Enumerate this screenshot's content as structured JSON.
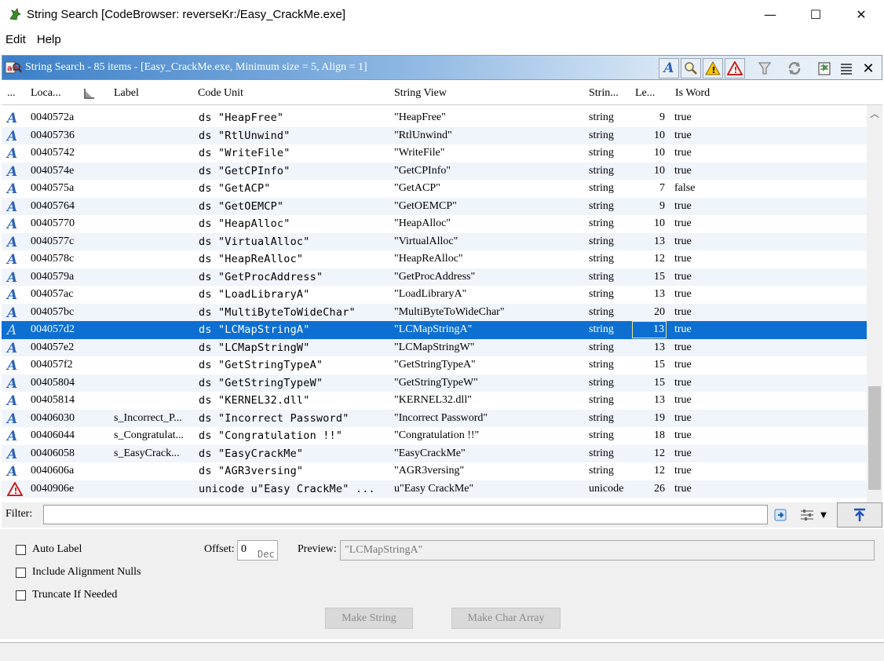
{
  "window": {
    "title": "String Search [CodeBrowser: reverseKr:/Easy_CrackMe.exe]",
    "controls": {
      "minimize": "—",
      "maximize": "☐",
      "close": "✕"
    }
  },
  "menu": [
    "Edit",
    "Help"
  ],
  "panel": {
    "title": "String Search - 85 items - [Easy_CrackMe.exe, Minimum size = 5, Align = 1]",
    "accent": "#3b7fc8"
  },
  "columns": {
    "icon": "...",
    "location": "Loca...",
    "label": "Label",
    "code_unit": "Code Unit",
    "string_view": "String View",
    "string_type": "Strin...",
    "length": "Le...",
    "is_word": "Is Word"
  },
  "rows": [
    {
      "icon": "A",
      "loc": "0040572a",
      "label": "",
      "code": "ds \"HeapFree\"",
      "view": "\"HeapFree\"",
      "type": "string",
      "len": "9",
      "word": "true"
    },
    {
      "icon": "A",
      "loc": "00405736",
      "label": "",
      "code": "ds \"RtlUnwind\"",
      "view": "\"RtlUnwind\"",
      "type": "string",
      "len": "10",
      "word": "true"
    },
    {
      "icon": "A",
      "loc": "00405742",
      "label": "",
      "code": "ds \"WriteFile\"",
      "view": "\"WriteFile\"",
      "type": "string",
      "len": "10",
      "word": "true"
    },
    {
      "icon": "A",
      "loc": "0040574e",
      "label": "",
      "code": "ds \"GetCPInfo\"",
      "view": "\"GetCPInfo\"",
      "type": "string",
      "len": "10",
      "word": "true"
    },
    {
      "icon": "A",
      "loc": "0040575a",
      "label": "",
      "code": "ds \"GetACP\"",
      "view": "\"GetACP\"",
      "type": "string",
      "len": "7",
      "word": "false"
    },
    {
      "icon": "A",
      "loc": "00405764",
      "label": "",
      "code": "ds \"GetOEMCP\"",
      "view": "\"GetOEMCP\"",
      "type": "string",
      "len": "9",
      "word": "true"
    },
    {
      "icon": "A",
      "loc": "00405770",
      "label": "",
      "code": "ds \"HeapAlloc\"",
      "view": "\"HeapAlloc\"",
      "type": "string",
      "len": "10",
      "word": "true"
    },
    {
      "icon": "A",
      "loc": "0040577c",
      "label": "",
      "code": "ds \"VirtualAlloc\"",
      "view": "\"VirtualAlloc\"",
      "type": "string",
      "len": "13",
      "word": "true"
    },
    {
      "icon": "A",
      "loc": "0040578c",
      "label": "",
      "code": "ds \"HeapReAlloc\"",
      "view": "\"HeapReAlloc\"",
      "type": "string",
      "len": "12",
      "word": "true"
    },
    {
      "icon": "A",
      "loc": "0040579a",
      "label": "",
      "code": "ds \"GetProcAddress\"",
      "view": "\"GetProcAddress\"",
      "type": "string",
      "len": "15",
      "word": "true"
    },
    {
      "icon": "A",
      "loc": "004057ac",
      "label": "",
      "code": "ds \"LoadLibraryA\"",
      "view": "\"LoadLibraryA\"",
      "type": "string",
      "len": "13",
      "word": "true"
    },
    {
      "icon": "A",
      "loc": "004057bc",
      "label": "",
      "code": "ds \"MultiByteToWideChar\"",
      "view": "\"MultiByteToWideChar\"",
      "type": "string",
      "len": "20",
      "word": "true"
    },
    {
      "icon": "A",
      "loc": "004057d2",
      "label": "",
      "code": "ds \"LCMapStringA\"",
      "view": "\"LCMapStringA\"",
      "type": "string",
      "len": "13",
      "word": "true",
      "selected": true
    },
    {
      "icon": "A",
      "loc": "004057e2",
      "label": "",
      "code": "ds \"LCMapStringW\"",
      "view": "\"LCMapStringW\"",
      "type": "string",
      "len": "13",
      "word": "true"
    },
    {
      "icon": "A",
      "loc": "004057f2",
      "label": "",
      "code": "ds \"GetStringTypeA\"",
      "view": "\"GetStringTypeA\"",
      "type": "string",
      "len": "15",
      "word": "true"
    },
    {
      "icon": "A",
      "loc": "00405804",
      "label": "",
      "code": "ds \"GetStringTypeW\"",
      "view": "\"GetStringTypeW\"",
      "type": "string",
      "len": "15",
      "word": "true"
    },
    {
      "icon": "A",
      "loc": "00405814",
      "label": "",
      "code": "ds \"KERNEL32.dll\"",
      "view": "\"KERNEL32.dll\"",
      "type": "string",
      "len": "13",
      "word": "true"
    },
    {
      "icon": "A",
      "loc": "00406030",
      "label": "s_Incorrect_P...",
      "code": "ds \"Incorrect Password\"",
      "view": "\"Incorrect Password\"",
      "type": "string",
      "len": "19",
      "word": "true"
    },
    {
      "icon": "A",
      "loc": "00406044",
      "label": "s_Congratulat...",
      "code": "ds \"Congratulation !!\"",
      "view": "\"Congratulation !!\"",
      "type": "string",
      "len": "18",
      "word": "true"
    },
    {
      "icon": "A",
      "loc": "00406058",
      "label": "s_EasyCrack...",
      "code": "ds \"EasyCrackMe\"",
      "view": "\"EasyCrackMe\"",
      "type": "string",
      "len": "12",
      "word": "true"
    },
    {
      "icon": "A",
      "loc": "0040606a",
      "label": "",
      "code": "ds \"AGR3versing\"",
      "view": "\"AGR3versing\"",
      "type": "string",
      "len": "12",
      "word": "true"
    },
    {
      "icon": "warn",
      "loc": "0040906e",
      "label": "",
      "code": "unicode u\"Easy CrackMe\" ...",
      "view": "u\"Easy CrackMe\"",
      "type": "unicode",
      "len": "26",
      "word": "true"
    }
  ],
  "filter": {
    "label": "Filter:",
    "value": ""
  },
  "options": {
    "auto_label": "Auto Label",
    "include_nulls": "Include Alignment Nulls",
    "truncate": "Truncate If Needed",
    "offset_label": "Offset:",
    "offset_value": "0",
    "offset_radix": "Dec",
    "preview_label": "Preview:",
    "preview_value": "\"LCMapStringA\"",
    "make_string": "Make String",
    "make_char_array": "Make Char Array"
  },
  "colors": {
    "selection": "#0d6fd1",
    "alt_row": "#f0f4fb",
    "string_icon": "#2c62b8",
    "warning": "#cc1f1f"
  }
}
